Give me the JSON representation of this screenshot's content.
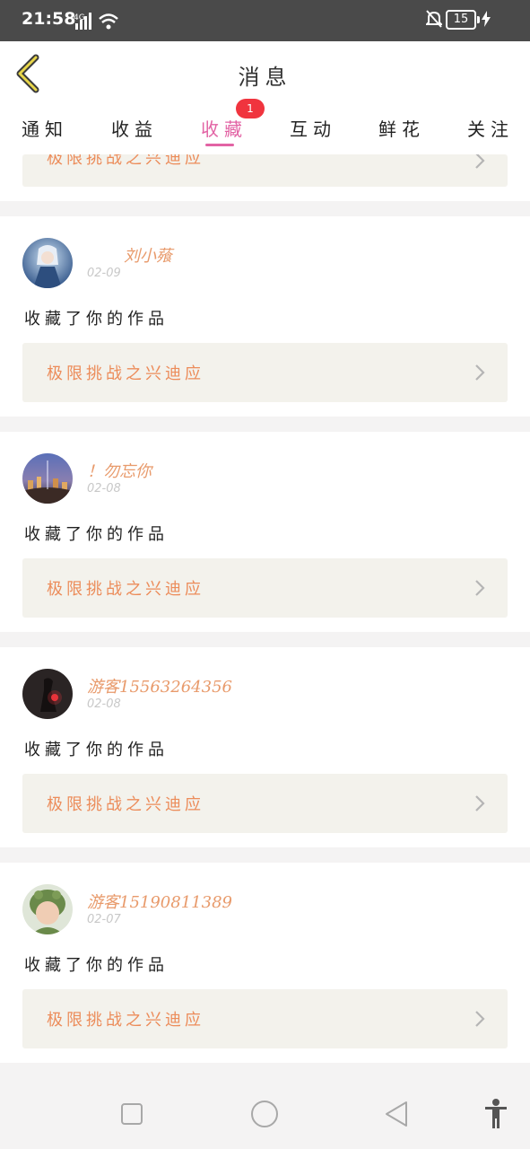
{
  "status_bar": {
    "time": "21:58",
    "network": "4G",
    "battery": "15"
  },
  "header": {
    "title": "消息"
  },
  "tabs": [
    {
      "label": "通知"
    },
    {
      "label": "收益"
    },
    {
      "label": "收藏",
      "badge": "1"
    },
    {
      "label": "互动"
    },
    {
      "label": "鲜花"
    },
    {
      "label": "关注"
    }
  ],
  "active_tab": "收藏",
  "colors": {
    "accent": "#e263a4",
    "badge": "#f0343e",
    "orange": "#ec8c5a",
    "card_bg": "#f3f2ec"
  },
  "partial_card": {
    "work_title": "极限挑战之兴迪应"
  },
  "notifications": [
    {
      "username": "刘小薞",
      "date": "02-09",
      "action": "收藏了你的作品",
      "work_title": "极限挑战之兴迪应"
    },
    {
      "username": "！勿忘你",
      "date": "02-08",
      "action": "收藏了你的作品",
      "work_title": "极限挑战之兴迪应"
    },
    {
      "username": "游客15563264356",
      "date": "02-08",
      "action": "收藏了你的作品",
      "work_title": "极限挑战之兴迪应"
    },
    {
      "username": "游客15190811389",
      "date": "02-07",
      "action": "收藏了你的作品",
      "work_title": "极限挑战之兴迪应"
    }
  ]
}
